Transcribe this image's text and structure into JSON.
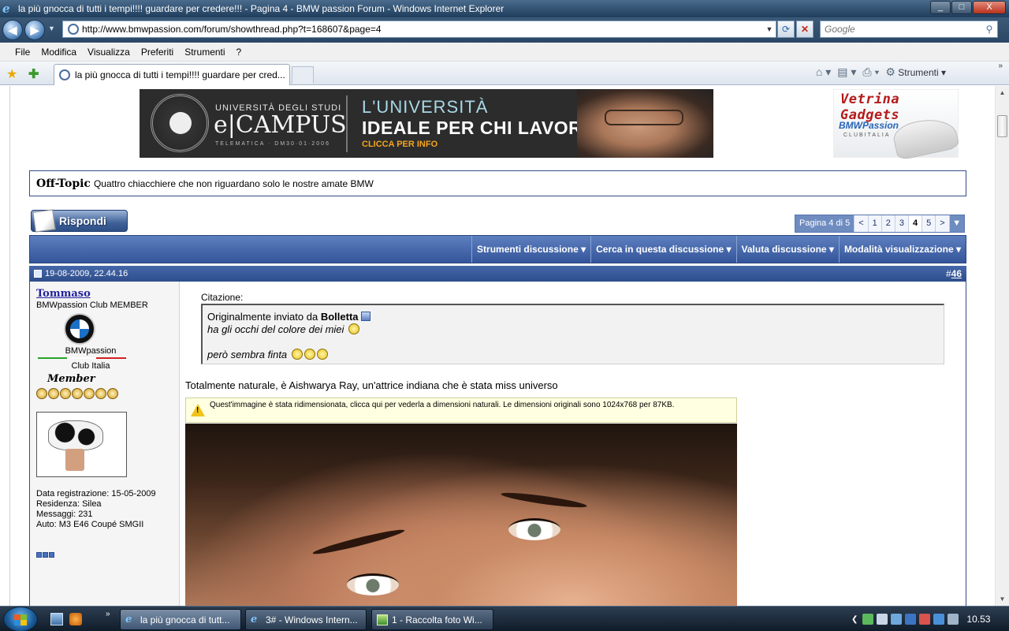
{
  "window": {
    "title": "la più gnocca di tutti i tempi!!!! guardare per credere!!! - Pagina 4 - BMW passion Forum - Windows Internet Explorer",
    "controls": {
      "minimize": "_",
      "maximize": "□",
      "close": "X"
    }
  },
  "address": {
    "url": "http://www.bmwpassion.com/forum/showthread.php?t=168607&page=4",
    "search_placeholder": "Google"
  },
  "menu": [
    "File",
    "Modifica",
    "Visualizza",
    "Preferiti",
    "Strumenti",
    "?"
  ],
  "tabs": {
    "active_title": "la più gnocca di tutti i tempi!!!! guardare per cred...",
    "tools_label": "Strumenti"
  },
  "banner": {
    "uni_small": "UNIVERSITÀ DEGLI STUDI",
    "brand": "e|CAMPUS",
    "telematica": "TELEMATICA · DM30·01·2006",
    "line1": "L'UNIVERSITÀ",
    "line2": "IDEALE PER CHI LAVORA",
    "cta": "CLICCA PER INFO"
  },
  "gadgets": {
    "title": "Vetrina Gadgets",
    "brand": "BMWPassion",
    "sub": "CLUBITALIA"
  },
  "forum": {
    "section_title": "Off-Topic",
    "section_desc": "Quattro chiacchiere che non riguardano solo le nostre amate BMW",
    "reply_label": "Rispondi",
    "pager": {
      "label": "Pagina 4 di 5",
      "prev": "<",
      "pages": [
        "1",
        "2",
        "3",
        "4",
        "5"
      ],
      "current": "4",
      "next": ">",
      "drop": "▼"
    },
    "thread_menus": [
      "Strumenti discussione",
      "Cerca in questa discussione",
      "Valuta discussione",
      "Modalità visualizzazione"
    ]
  },
  "post": {
    "date": "19-08-2009, 22.44.16",
    "number_prefix": "#",
    "number": "46",
    "user": {
      "name": "Tommaso",
      "title": "BMWpassion Club MEMBER",
      "club_name": "BMWpassion",
      "club_sub": "Club Italia",
      "rank": "Member",
      "rep_count": 7,
      "stats": [
        "Data registrazione: 15-05-2009",
        "Residenza: Silea",
        "Messaggi: 231",
        "Auto: M3 E46 Coupé SMGII"
      ]
    },
    "quote": {
      "label": "Citazione:",
      "intro": "Originalmente inviato da",
      "author": "Bolletta",
      "line1": "ha gli occhi del colore dei miei",
      "line2": "però sembra finta"
    },
    "text": "Totalmente naturale, è Aishwarya Ray, un'attrice indiana che è stata miss universo",
    "resize_notice": "Quest'immagine è stata ridimensionata, clicca qui per vederla a dimensioni naturali. Le dimensioni originali sono 1024x768 per 87KB."
  },
  "taskbar": {
    "items": [
      "la più gnocca di tutt...",
      "3# - Windows Intern...",
      "1 - Raccolta foto Wi..."
    ],
    "clock": "10.53"
  },
  "colors": {
    "forum_blue": "#3e5fa0",
    "link": "#22229c",
    "banner_cta": "#f3a51f",
    "gadgets_red": "#b51a1a"
  }
}
